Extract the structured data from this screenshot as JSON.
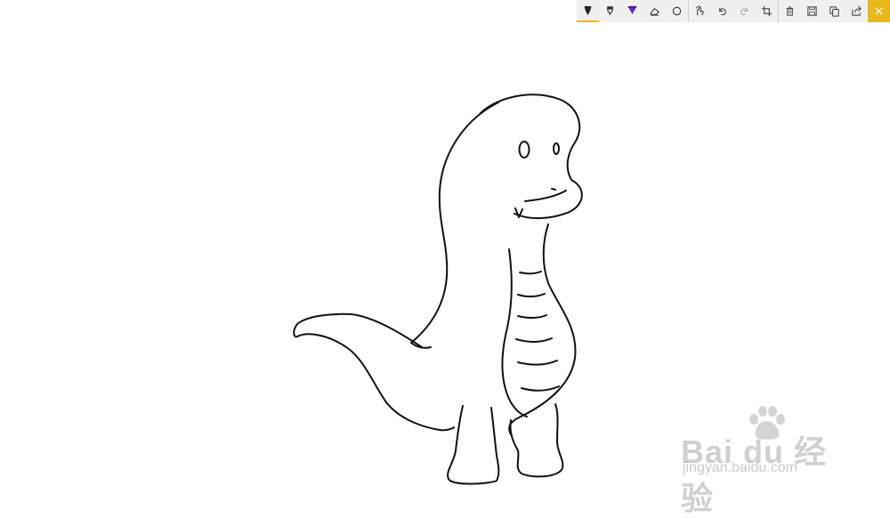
{
  "toolbar": {
    "tools": [
      {
        "id": "ballpoint-pen",
        "icon": "ballpoint-pen-icon",
        "active": true,
        "color": "#222222"
      },
      {
        "id": "pencil",
        "icon": "pencil-icon",
        "active": false,
        "color": "#333333"
      },
      {
        "id": "highlighter",
        "icon": "highlighter-icon",
        "active": false,
        "color": "#5b2bd6"
      },
      {
        "id": "eraser",
        "icon": "eraser-icon",
        "active": false
      },
      {
        "id": "shape",
        "icon": "circle-shape-icon",
        "active": false
      }
    ],
    "actions": [
      {
        "id": "touch-writing",
        "icon": "touch-writing-icon"
      },
      {
        "id": "undo",
        "icon": "undo-icon"
      },
      {
        "id": "redo",
        "icon": "redo-icon",
        "disabled": true
      },
      {
        "id": "crop",
        "icon": "crop-icon"
      }
    ],
    "file_actions": [
      {
        "id": "delete",
        "icon": "trash-icon"
      },
      {
        "id": "save",
        "icon": "save-icon"
      },
      {
        "id": "copy",
        "icon": "copy-icon"
      },
      {
        "id": "share",
        "icon": "share-icon"
      }
    ],
    "close": {
      "icon": "close-icon",
      "color": "#e8b81a"
    }
  },
  "canvas": {
    "subject": "dinosaur-line-drawing",
    "stroke_color": "#111111"
  },
  "watermark": {
    "main": "Bai du 经验",
    "sub": "jingyan.baidu.com"
  }
}
